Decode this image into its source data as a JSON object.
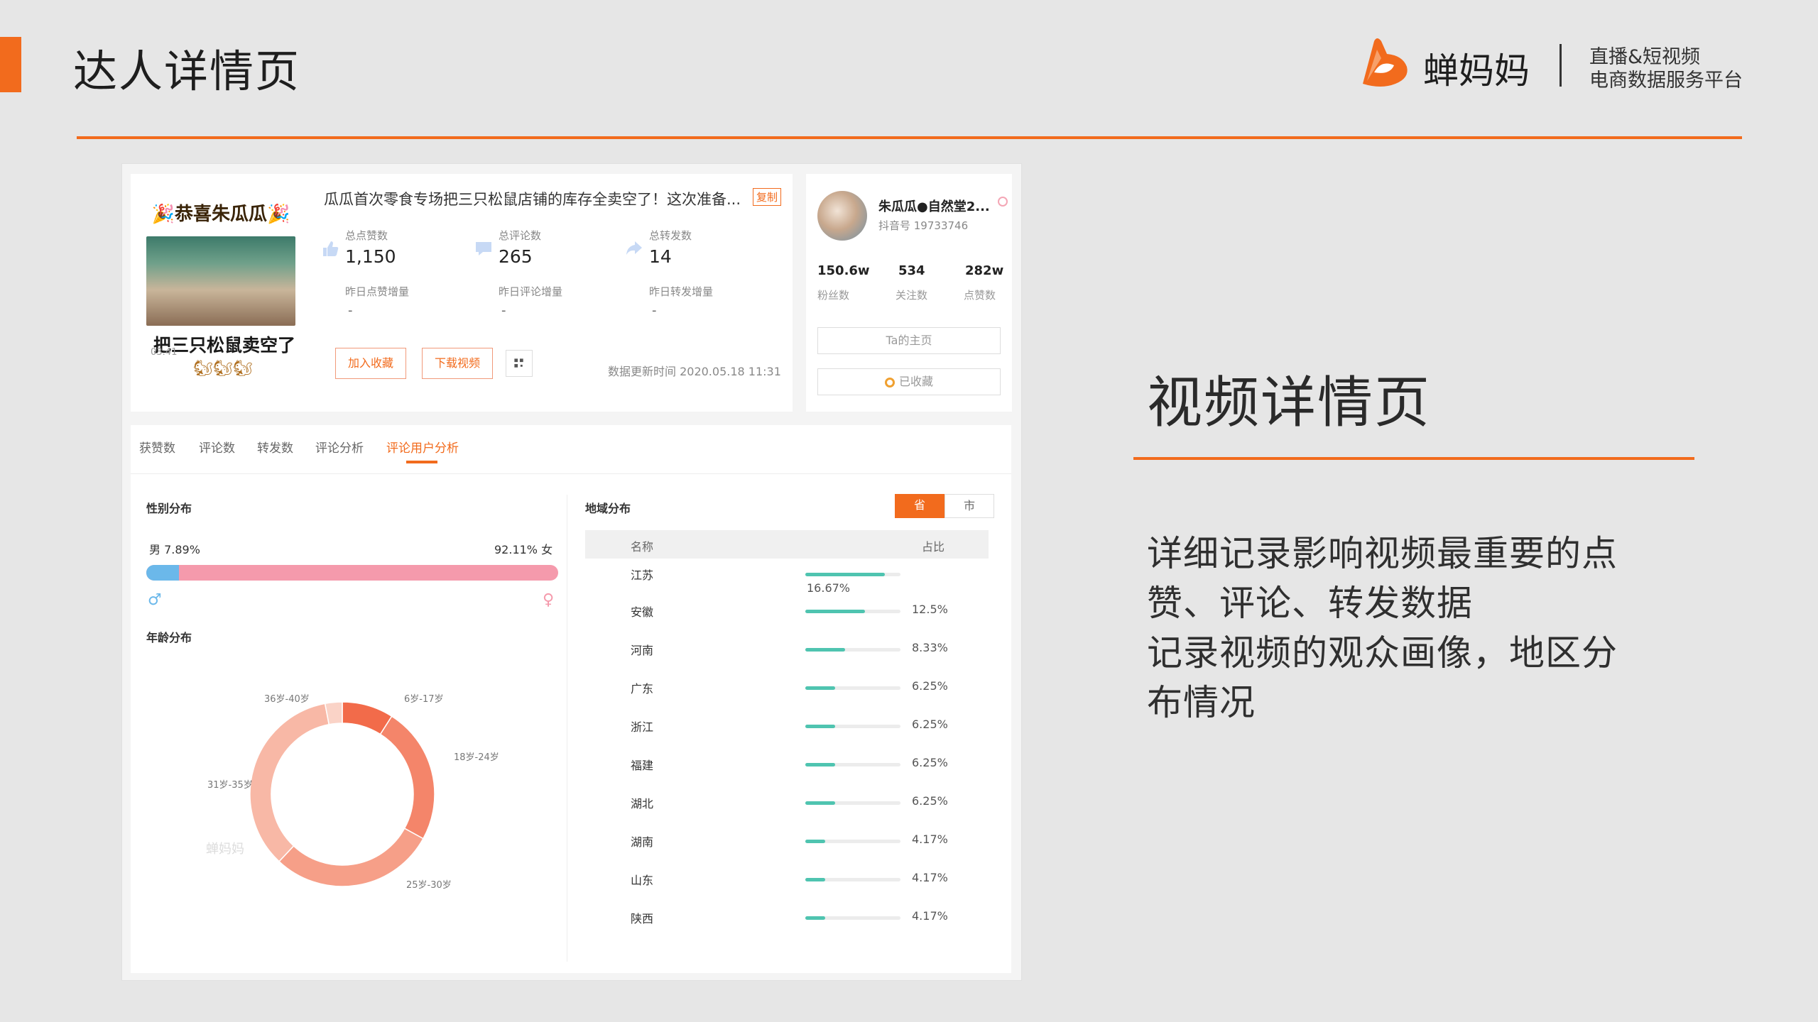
{
  "slide": {
    "title": "达人详情页",
    "brand": "蝉妈妈",
    "tagline_1": "直播&短视频",
    "tagline_2": "电商数据服务平台",
    "accent_color": "#f26b1d"
  },
  "side_panel": {
    "title": "视频详情页",
    "lines": [
      "详细记录影响视频最重要的点",
      "赞、评论、转发数据",
      "记录视频的观众画像，地区分",
      "布情况"
    ]
  },
  "video": {
    "thumb_banner": "🎉恭喜朱瓜瓜🎉",
    "thumb_caption": "把三只松鼠卖空了",
    "thumb_time": "03:41",
    "title": "瓜瓜首次零食专场把三只松鼠店铺的库存全卖空了！这次准备...",
    "copy_label": "复制",
    "stats": [
      {
        "icon": "thumbs-up-icon",
        "label": "总点赞数",
        "value": "1,150",
        "delta_label": "昨日点赞增量",
        "delta": "-"
      },
      {
        "icon": "comment-icon",
        "label": "总评论数",
        "value": "265",
        "delta_label": "昨日评论增量",
        "delta": "-"
      },
      {
        "icon": "share-icon",
        "label": "总转发数",
        "value": "14",
        "delta_label": "昨日转发增量",
        "delta": "-"
      }
    ],
    "btn_favorite": "加入收藏",
    "btn_download": "下载视频",
    "update_time": "数据更新时间 2020.05.18 11:31"
  },
  "author": {
    "name": "朱瓜瓜●自然堂2...",
    "douyin_id": "抖音号  19733746",
    "stats": [
      {
        "value": "150.6w",
        "label": "粉丝数"
      },
      {
        "value": "534",
        "label": "关注数"
      },
      {
        "value": "282w",
        "label": "点赞数"
      }
    ],
    "btn_home": "Ta的主页",
    "btn_saved": "已收藏"
  },
  "tabs": [
    {
      "label": "获赞数",
      "active": false
    },
    {
      "label": "评论数",
      "active": false
    },
    {
      "label": "转发数",
      "active": false
    },
    {
      "label": "评论分析",
      "active": false
    },
    {
      "label": "评论用户分析",
      "active": true
    }
  ],
  "gender": {
    "title": "性别分布",
    "male_label": "男 7.89%",
    "female_label": "92.11% 女",
    "male_fraction": 0.0789,
    "male_color": "#6bb8ea",
    "female_color": "#f59aac"
  },
  "age": {
    "title": "年龄分布",
    "segments": [
      {
        "label": "6岁-17岁",
        "value": 9
      },
      {
        "label": "18岁-24岁",
        "value": 24
      },
      {
        "label": "25岁-30岁",
        "value": 29
      },
      {
        "label": "31岁-35岁",
        "value": 35
      },
      {
        "label": "36岁-40岁",
        "value": 3
      }
    ],
    "colors": [
      "#f26b4a",
      "#f4856a",
      "#f69f88",
      "#f8b8a6",
      "#fad3c7"
    ],
    "watermark": "蝉妈妈"
  },
  "region": {
    "title": "地域分布",
    "toggle_on": "省",
    "toggle_off": "市",
    "col_name": "名称",
    "col_share": "占比",
    "rows": [
      {
        "name": "江苏",
        "pct": "16.67%",
        "value": 16.67
      },
      {
        "name": "安徽",
        "pct": "12.5%",
        "value": 12.5
      },
      {
        "name": "河南",
        "pct": "8.33%",
        "value": 8.33
      },
      {
        "name": "广东",
        "pct": "6.25%",
        "value": 6.25
      },
      {
        "name": "浙江",
        "pct": "6.25%",
        "value": 6.25
      },
      {
        "name": "福建",
        "pct": "6.25%",
        "value": 6.25
      },
      {
        "name": "湖北",
        "pct": "6.25%",
        "value": 6.25
      },
      {
        "name": "湖南",
        "pct": "4.17%",
        "value": 4.17
      },
      {
        "name": "山东",
        "pct": "4.17%",
        "value": 4.17
      },
      {
        "name": "陕西",
        "pct": "4.17%",
        "value": 4.17
      }
    ]
  }
}
